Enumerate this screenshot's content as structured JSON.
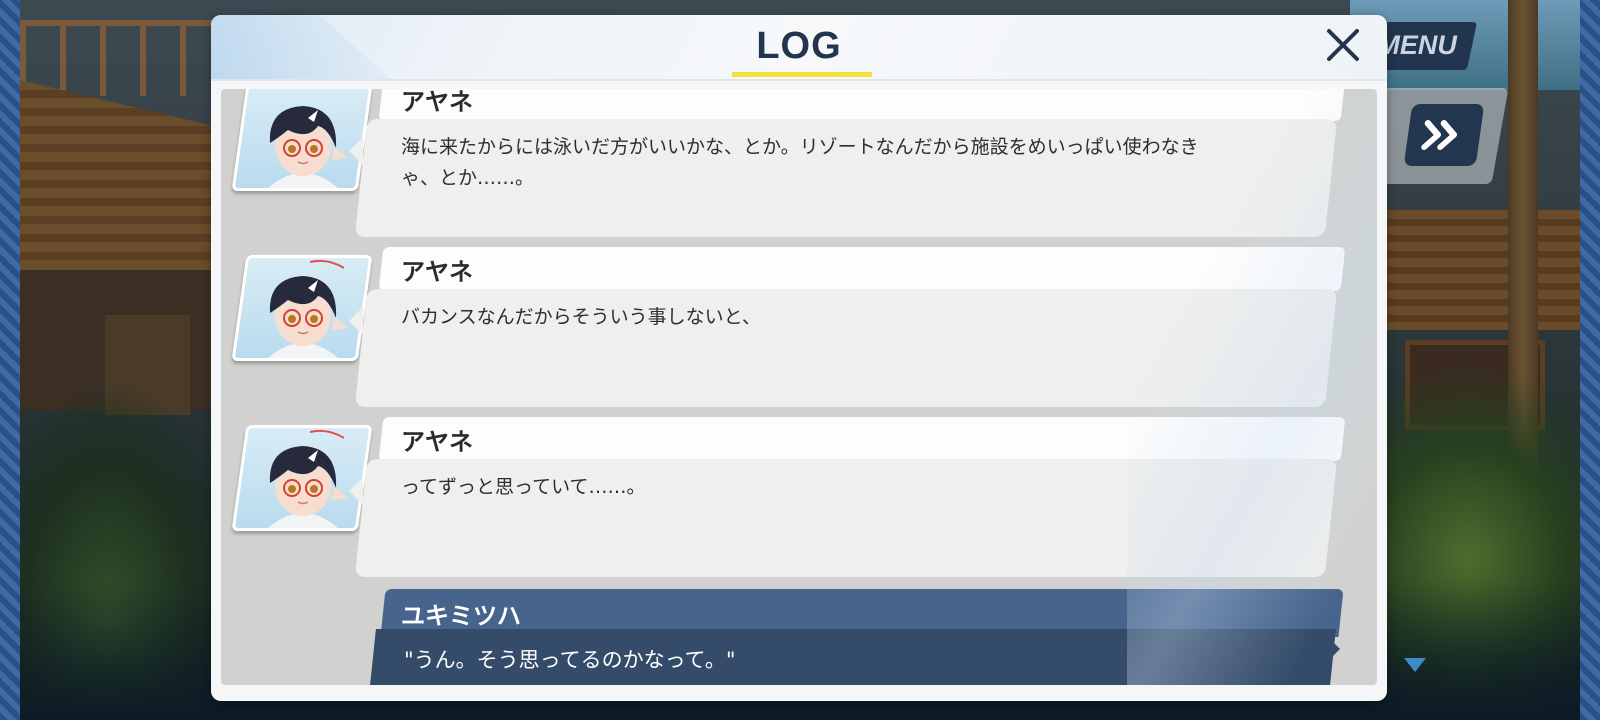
{
  "menu": {
    "label": "MENU"
  },
  "log": {
    "title": "LOG",
    "entries": [
      {
        "speaker": "アヤネ",
        "lines": [
          "海に来たからには泳いだ方がいいかな、とか。リゾートなんだから施設をめいっぱい使わなき",
          "ゃ、とか……。"
        ]
      },
      {
        "speaker": "アヤネ",
        "lines": [
          "バカンスなんだからそういう事しないと、"
        ]
      },
      {
        "speaker": "アヤネ",
        "lines": [
          "ってずっと思っていて……。"
        ]
      }
    ],
    "player": {
      "speaker": "ユキミツハ",
      "text": "\"うん。そう思ってるのかなって。\""
    }
  },
  "colors": {
    "accent_underline": "#f3e03a",
    "player_header": "#46648c",
    "player_bubble": "#344b69",
    "title_text": "#23354d"
  },
  "icons": {
    "close": "close-icon",
    "skip": "fast-forward-icon",
    "scroll": "chevron-down-icon",
    "portrait": "character-portrait-ayane"
  }
}
